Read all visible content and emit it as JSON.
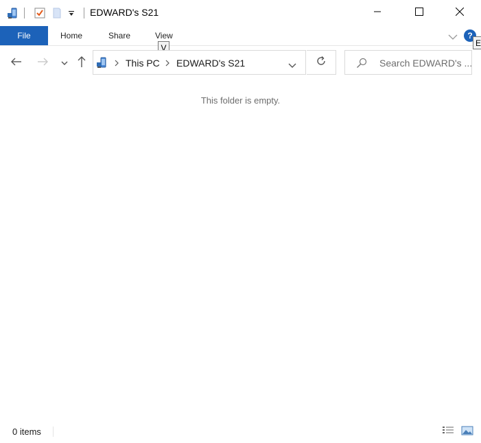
{
  "window": {
    "title": "EDWARD's S21"
  },
  "quick_access": {
    "icons": [
      "phone-device-icon",
      "properties-checkmark-icon",
      "new-folder-icon",
      "customize-dropdown-icon"
    ]
  },
  "window_controls": [
    "minimize-icon",
    "maximize-icon",
    "close-icon"
  ],
  "ribbon": {
    "file_label": "File",
    "tabs": [
      {
        "label": "Home"
      },
      {
        "label": "Share"
      },
      {
        "label": "View"
      }
    ],
    "keytip": "V",
    "keytip_right": "E",
    "help_label": "?"
  },
  "navigation": {
    "breadcrumbs": [
      {
        "label": "This PC"
      },
      {
        "label": "EDWARD's S21"
      }
    ]
  },
  "search": {
    "placeholder": "Search EDWARD's ..."
  },
  "content": {
    "empty_message": "This folder is empty."
  },
  "status_bar": {
    "item_count": "0 items"
  },
  "colors": {
    "accent": "#1c62b9",
    "muted_text": "#6d6d6d",
    "border": "#d9d9d9"
  }
}
